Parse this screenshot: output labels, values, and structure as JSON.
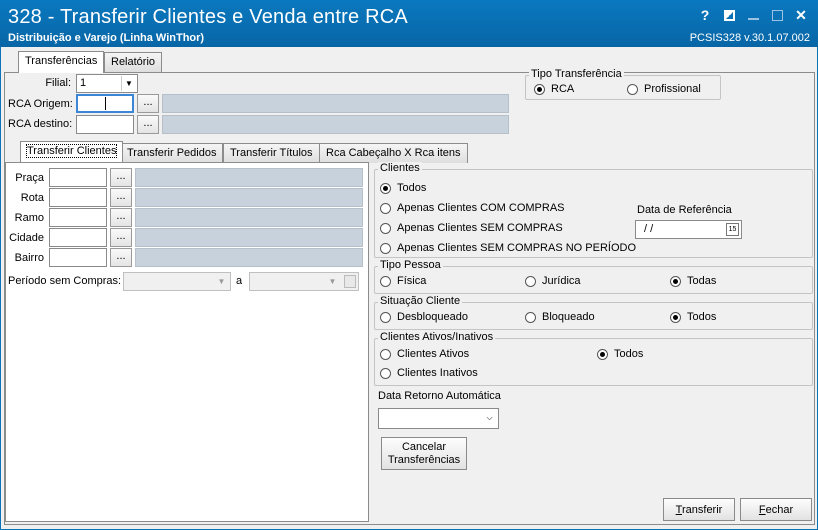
{
  "window": {
    "title": "328 - Transferir  Clientes e Venda entre RCA",
    "subtitle": "Distribuição e Varejo (Linha WinThor)",
    "version": "PCSIS328  v.30.1.07.002",
    "buttons": {
      "help": "?",
      "restore_icon": "window-style-icon",
      "minimize": "minimize-icon",
      "maximize": "maximize-icon",
      "close": "✕"
    }
  },
  "main_tabs": [
    "Transferências",
    "Relatório"
  ],
  "header": {
    "filial_label": "Filial:",
    "filial_value": "1",
    "rca_origem_label": "RCA Origem:",
    "rca_destino_label": "RCA destino:",
    "ellipsis": "..."
  },
  "tipo_transferencia": {
    "title": "Tipo Transferência",
    "options": [
      "RCA",
      "Profissional"
    ],
    "selected": "RCA"
  },
  "sub_tabs": [
    "Transferir Clientes",
    "Transferir Pedidos",
    "Transferir Títulos",
    "Rca Cabeçalho X Rca itens"
  ],
  "filters": {
    "praca": "Praça",
    "rota": "Rota",
    "ramo": "Ramo",
    "cidade": "Cidade",
    "bairro": "Bairro",
    "periodo_label": "Período sem Compras:",
    "periodo_a": "a"
  },
  "clientes": {
    "title": "Clientes",
    "options": [
      "Todos",
      "Apenas Clientes COM COMPRAS",
      "Apenas Clientes SEM COMPRAS",
      "Apenas Clientes SEM COMPRAS NO PERÍODO"
    ],
    "selected": "Todos",
    "data_referencia_label": "Data de Referência",
    "data_referencia_value": "/ /"
  },
  "tipo_pessoa": {
    "title": "Tipo Pessoa",
    "options": [
      "Física",
      "Jurídica",
      "Todas"
    ],
    "selected": "Todas"
  },
  "situacao_cliente": {
    "title": "Situação Cliente",
    "options": [
      "Desbloqueado",
      "Bloqueado",
      "Todos"
    ],
    "selected": "Todos"
  },
  "clientes_ativos": {
    "title": "Clientes Ativos/Inativos",
    "options": [
      "Clientes Ativos",
      "Todos",
      "Clientes Inativos"
    ],
    "selected": "Todos"
  },
  "data_retorno": {
    "label": "Data Retorno Automática",
    "value": ""
  },
  "buttons": {
    "cancelar_line1": "Cancelar",
    "cancelar_line2": "Transferências",
    "transferir_underline": "T",
    "transferir_rest": "ransferir",
    "fechar_underline": "F",
    "fechar_rest": "echar"
  }
}
